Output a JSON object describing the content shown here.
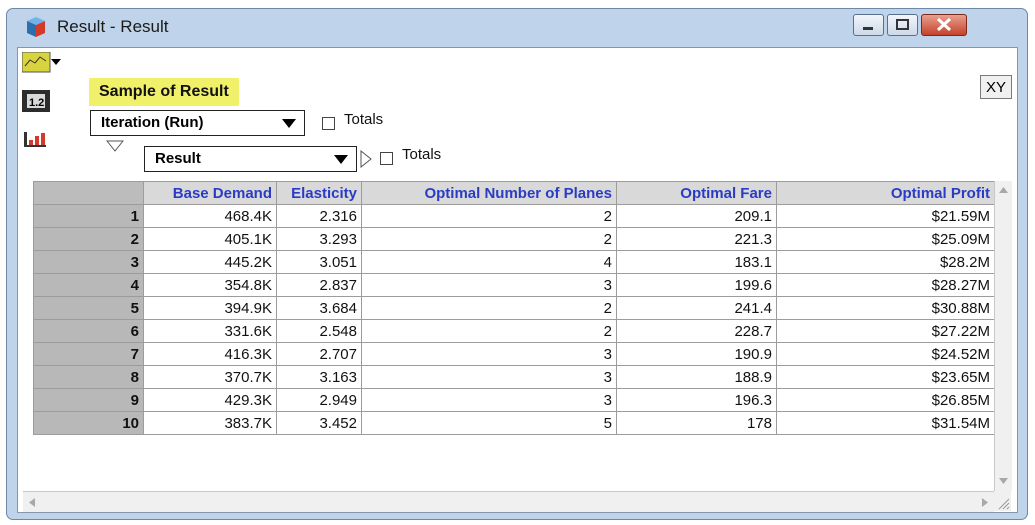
{
  "window": {
    "title": "Result - Result"
  },
  "panel": {
    "sample_title": "Sample of Result",
    "xy_label": "XY"
  },
  "controls": {
    "iteration_dropdown": "Iteration (Run)",
    "result_dropdown": "Result",
    "totals_label_1": "Totals",
    "totals_label_2": "Totals"
  },
  "table": {
    "columns": [
      "Base Demand",
      "Elasticity",
      "Optimal Number of Planes",
      "Optimal Fare",
      "Optimal Profit"
    ],
    "rows": [
      {
        "index": "1",
        "cells": [
          "468.4K",
          "2.316",
          "2",
          "209.1",
          "$21.59M"
        ]
      },
      {
        "index": "2",
        "cells": [
          "405.1K",
          "3.293",
          "2",
          "221.3",
          "$25.09M"
        ]
      },
      {
        "index": "3",
        "cells": [
          "445.2K",
          "3.051",
          "4",
          "183.1",
          "$28.2M"
        ]
      },
      {
        "index": "4",
        "cells": [
          "354.8K",
          "2.837",
          "3",
          "199.6",
          "$28.27M"
        ]
      },
      {
        "index": "5",
        "cells": [
          "394.9K",
          "3.684",
          "2",
          "241.4",
          "$30.88M"
        ]
      },
      {
        "index": "6",
        "cells": [
          "331.6K",
          "2.548",
          "2",
          "228.7",
          "$27.22M"
        ]
      },
      {
        "index": "7",
        "cells": [
          "416.3K",
          "2.707",
          "3",
          "190.9",
          "$24.52M"
        ]
      },
      {
        "index": "8",
        "cells": [
          "370.7K",
          "3.163",
          "3",
          "188.9",
          "$23.65M"
        ]
      },
      {
        "index": "9",
        "cells": [
          "429.3K",
          "2.949",
          "3",
          "196.3",
          "$26.85M"
        ]
      },
      {
        "index": "10",
        "cells": [
          "383.7K",
          "3.452",
          "5",
          "178",
          "$31.54M"
        ]
      }
    ]
  },
  "icons": {
    "app": "analytica-app-icon",
    "graph_toggle": "graph-view-icon",
    "table_toggle": "table-view-icon",
    "chart_toggle": "bar-chart-icon"
  },
  "colors": {
    "header_text": "#2b3cc4",
    "sample_highlight": "#f1f06a",
    "row_header": "#b8b8b8"
  }
}
